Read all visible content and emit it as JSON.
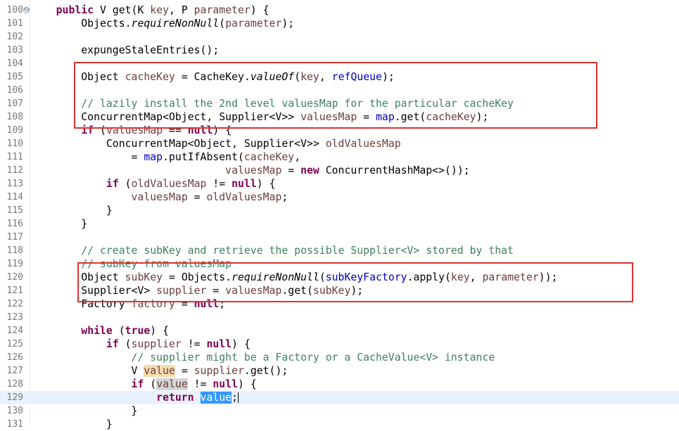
{
  "editor": {
    "current_line": 129,
    "lines": [
      {
        "n": "100",
        "fold": "⊖",
        "tokens": [
          [
            "    ",
            ""
          ],
          [
            "public",
            "kw"
          ],
          [
            " V get(K ",
            ""
          ],
          [
            "key",
            "loc"
          ],
          [
            ", P ",
            ""
          ],
          [
            "parameter",
            "loc"
          ],
          [
            ") {",
            ""
          ]
        ]
      },
      {
        "n": "101",
        "tokens": [
          [
            "        Objects.",
            ""
          ],
          [
            "requireNonNull",
            "it"
          ],
          [
            "(",
            ""
          ],
          [
            "parameter",
            "loc"
          ],
          [
            ");",
            ""
          ]
        ]
      },
      {
        "n": "102",
        "tokens": []
      },
      {
        "n": "103",
        "tokens": [
          [
            "        expungeStaleEntries();",
            ""
          ]
        ]
      },
      {
        "n": "104",
        "tokens": []
      },
      {
        "n": "105",
        "tokens": [
          [
            "        Object ",
            ""
          ],
          [
            "cacheKey",
            "loc"
          ],
          [
            " = CacheKey.",
            ""
          ],
          [
            "valueOf",
            "it"
          ],
          [
            "(",
            ""
          ],
          [
            "key",
            "loc"
          ],
          [
            ", ",
            ""
          ],
          [
            "refQueue",
            "fld"
          ],
          [
            ");",
            ""
          ]
        ]
      },
      {
        "n": "106",
        "tokens": []
      },
      {
        "n": "107",
        "tokens": [
          [
            "        // lazily install the 2nd level valuesMap for the particular cacheKey",
            "cmt"
          ]
        ]
      },
      {
        "n": "108",
        "tokens": [
          [
            "        ConcurrentMap<Object, Supplier<V>> ",
            ""
          ],
          [
            "valuesMap",
            "loc"
          ],
          [
            " = ",
            ""
          ],
          [
            "map",
            "fld"
          ],
          [
            ".get(",
            ""
          ],
          [
            "cacheKey",
            "loc"
          ],
          [
            ");",
            ""
          ]
        ]
      },
      {
        "n": "109",
        "tokens": [
          [
            "        ",
            ""
          ],
          [
            "if",
            "kw"
          ],
          [
            " (",
            ""
          ],
          [
            "valuesMap",
            "loc"
          ],
          [
            " == ",
            ""
          ],
          [
            "null",
            "kw"
          ],
          [
            ") {",
            ""
          ]
        ]
      },
      {
        "n": "110",
        "tokens": [
          [
            "            ConcurrentMap<Object, Supplier<V>> ",
            ""
          ],
          [
            "oldValuesMap",
            "loc"
          ]
        ]
      },
      {
        "n": "111",
        "tokens": [
          [
            "                = ",
            ""
          ],
          [
            "map",
            "fld"
          ],
          [
            ".putIfAbsent(",
            ""
          ],
          [
            "cacheKey",
            "loc"
          ],
          [
            ",",
            ""
          ]
        ]
      },
      {
        "n": "112",
        "tokens": [
          [
            "                               ",
            ""
          ],
          [
            "valuesMap",
            "loc"
          ],
          [
            " = ",
            ""
          ],
          [
            "new",
            "kw"
          ],
          [
            " ConcurrentHashMap<>());",
            ""
          ]
        ]
      },
      {
        "n": "113",
        "tokens": [
          [
            "            ",
            ""
          ],
          [
            "if",
            "kw"
          ],
          [
            " (",
            ""
          ],
          [
            "oldValuesMap",
            "loc"
          ],
          [
            " != ",
            ""
          ],
          [
            "null",
            "kw"
          ],
          [
            ") {",
            ""
          ]
        ]
      },
      {
        "n": "114",
        "tokens": [
          [
            "                ",
            ""
          ],
          [
            "valuesMap",
            "loc"
          ],
          [
            " = ",
            ""
          ],
          [
            "oldValuesMap",
            "loc"
          ],
          [
            ";",
            ""
          ]
        ]
      },
      {
        "n": "115",
        "tokens": [
          [
            "            }",
            ""
          ]
        ]
      },
      {
        "n": "116",
        "tokens": [
          [
            "        }",
            ""
          ]
        ]
      },
      {
        "n": "117",
        "tokens": []
      },
      {
        "n": "118",
        "tokens": [
          [
            "        // create subKey and retrieve the possible Supplier<V> stored by that",
            "cmt"
          ]
        ]
      },
      {
        "n": "119",
        "tokens": [
          [
            "        // subKey from valuesMap",
            "cmt"
          ]
        ]
      },
      {
        "n": "120",
        "tokens": [
          [
            "        Object ",
            ""
          ],
          [
            "subKey",
            "loc"
          ],
          [
            " = Objects.",
            ""
          ],
          [
            "requireNonNull",
            "it"
          ],
          [
            "(",
            ""
          ],
          [
            "subKeyFactory",
            "fld"
          ],
          [
            ".apply(",
            ""
          ],
          [
            "key",
            "loc"
          ],
          [
            ", ",
            ""
          ],
          [
            "parameter",
            "loc"
          ],
          [
            "));",
            ""
          ]
        ]
      },
      {
        "n": "121",
        "tokens": [
          [
            "        Supplier<V> ",
            ""
          ],
          [
            "supplier",
            "loc"
          ],
          [
            " = ",
            ""
          ],
          [
            "valuesMap",
            "loc"
          ],
          [
            ".get(",
            ""
          ],
          [
            "subKey",
            "loc"
          ],
          [
            ");",
            ""
          ]
        ]
      },
      {
        "n": "122",
        "tokens": [
          [
            "        Factory ",
            ""
          ],
          [
            "factory",
            "loc"
          ],
          [
            " = ",
            ""
          ],
          [
            "null",
            "kw"
          ],
          [
            ";",
            ""
          ]
        ]
      },
      {
        "n": "123",
        "tokens": []
      },
      {
        "n": "124",
        "tokens": [
          [
            "        ",
            ""
          ],
          [
            "while",
            "kw"
          ],
          [
            " (",
            ""
          ],
          [
            "true",
            "kw"
          ],
          [
            ") {",
            ""
          ]
        ]
      },
      {
        "n": "125",
        "tokens": [
          [
            "            ",
            ""
          ],
          [
            "if",
            "kw"
          ],
          [
            " (",
            ""
          ],
          [
            "supplier",
            "loc"
          ],
          [
            " != ",
            ""
          ],
          [
            "null",
            "kw"
          ],
          [
            ") {",
            ""
          ]
        ]
      },
      {
        "n": "126",
        "tokens": [
          [
            "                // supplier might be a Factory or a CacheValue<V> instance",
            "cmt"
          ]
        ]
      },
      {
        "n": "127",
        "tokens": [
          [
            "                V ",
            ""
          ],
          [
            "value",
            "loc occw"
          ],
          [
            " = ",
            ""
          ],
          [
            "supplier",
            "loc"
          ],
          [
            ".get();",
            ""
          ]
        ]
      },
      {
        "n": "128",
        "tokens": [
          [
            "                ",
            ""
          ],
          [
            "if",
            "kw"
          ],
          [
            " (",
            ""
          ],
          [
            "value",
            "loc occr"
          ],
          [
            " != ",
            ""
          ],
          [
            "null",
            "kw"
          ],
          [
            ") {",
            ""
          ]
        ]
      },
      {
        "n": "129",
        "tokens": [
          [
            "                    ",
            ""
          ],
          [
            "return",
            "kw"
          ],
          [
            " ",
            ""
          ],
          [
            "value",
            "sel"
          ],
          [
            ";",
            ""
          ]
        ],
        "caret_after": 4
      },
      {
        "n": "130",
        "tokens": [
          [
            "                }",
            ""
          ]
        ]
      },
      {
        "n": "131",
        "tokens": [
          [
            "            }",
            ""
          ]
        ]
      }
    ],
    "highlight_boxes": [
      {
        "from_line": "105",
        "to_line": "108"
      },
      {
        "from_line": "120",
        "to_line": "121"
      }
    ]
  }
}
